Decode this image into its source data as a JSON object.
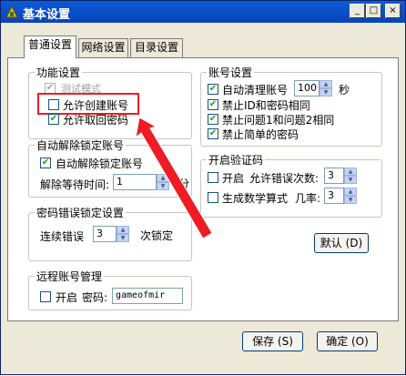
{
  "window": {
    "title": "基本设置",
    "min": "_",
    "max": "□",
    "close": "×"
  },
  "tabs": [
    {
      "label": "普通设置"
    },
    {
      "label": "网络设置"
    },
    {
      "label": "目录设置"
    }
  ],
  "func": {
    "legend": "功能设置",
    "test_mode": "测试模式",
    "allow_create": "允许创建账号",
    "allow_recover": "允许取回密码"
  },
  "auto_unlock": {
    "legend": "自动解除锁定账号",
    "enabled": "自动解除锁定账号",
    "wait_label": "解除等待时间:",
    "wait_value": "1",
    "unit": "分"
  },
  "pwd_lock": {
    "legend": "密码错误锁定设置",
    "prefix": "连续错误",
    "value": "3",
    "suffix": "次锁定"
  },
  "remote": {
    "legend": "远程账号管理",
    "enable": "开启",
    "pwd_label": "密码:",
    "pwd_value": "gameofmir"
  },
  "account": {
    "legend": "账号设置",
    "auto_clean": "自动清理账号",
    "clean_value": "100",
    "clean_unit": "秒",
    "ban_same_id_pwd": "禁止ID和密码相同",
    "ban_same_q": "禁止问题1和问题2相同",
    "ban_simple_pwd": "禁止简单的密码"
  },
  "captcha": {
    "legend": "开启验证码",
    "enable": "开启",
    "allow_errors": "允许错误次数:",
    "errors_value": "3",
    "math": "生成数学算式",
    "prob": "几率:",
    "prob_value": "3"
  },
  "buttons": {
    "default": "默认 (D)",
    "save": "保存 (S)",
    "ok": "确定 (O)"
  },
  "colors": {
    "titlebar": "#0a44b8",
    "highlight": "#ee1c25",
    "check": "#21a121"
  }
}
